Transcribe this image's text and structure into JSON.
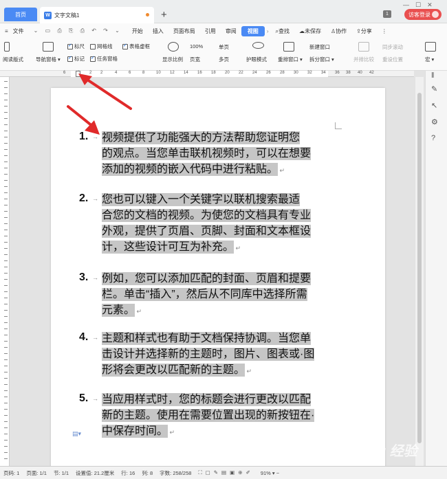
{
  "tabs": {
    "home": "首页",
    "doc": "文字文稿1"
  },
  "titlebar": {
    "page_badge": "1",
    "login": "访客登录"
  },
  "menu": {
    "file": "文件",
    "items": [
      "开始",
      "插入",
      "页面布局",
      "引用",
      "审阅",
      "视图"
    ],
    "search": "查找",
    "unsaved": "未保存",
    "collab": "协作",
    "share": "分享"
  },
  "toolbar": {
    "readmode": "阅读版式",
    "nav": "导航窗格",
    "ruler": "标尺",
    "gridlines": "网格线",
    "tableframe": "表格虚框",
    "marks": "标记",
    "taskpane": "任务窗格",
    "zoom": "显示比例",
    "zoom100": "100%",
    "pagewidth": "页宽",
    "single": "单页",
    "multi": "多页",
    "eyecare": "护眼模式",
    "rearrange": "重排窗口",
    "newwin": "新建窗口",
    "split": "拆分窗口",
    "compare": "并排比较",
    "syncscroll": "同步滚动",
    "resetpos": "重设位置",
    "macro": "宏"
  },
  "ruler": {
    "nums": [
      "6",
      "4",
      "2",
      "2",
      "4",
      "6",
      "8",
      "10",
      "12",
      "14",
      "16",
      "18",
      "20",
      "22",
      "24",
      "26",
      "28",
      "30",
      "32",
      "34",
      "36",
      "38",
      "40",
      "42",
      "44",
      "46"
    ]
  },
  "document": {
    "items": [
      {
        "num": "1.",
        "lines": [
          "视频提供了功能强大的方法帮助您证明您",
          "的观点。当您单击联机视频时，可以在想要",
          "添加的视频的嵌入代码中进行粘贴。"
        ]
      },
      {
        "num": "2.",
        "lines": [
          "您也可以键入一个关键字以联机搜索最适",
          "合您的文档的视频。为使您的文档具有专业",
          "外观，提供了页眉、页脚、封面和文本框设",
          "计，这些设计可互为补充。"
        ]
      },
      {
        "num": "3.",
        "lines": [
          "例如，您可以添加匹配的封面、页眉和提要",
          "栏。单击“插入”，然后从不同库中选择所需",
          "元素。"
        ]
      },
      {
        "num": "4.",
        "lines": [
          "主题和样式也有助于文档保持协调。当您单",
          "击设计并选择新的主题时，图片、图表或·图",
          "形将会更改以匹配新的主题。"
        ]
      },
      {
        "num": "5.",
        "lines": [
          "当应用样式时，您的标题会进行更改以匹配",
          "新的主题。使用在需要位置出现的新按钮在·",
          "中保存时间。"
        ]
      }
    ]
  },
  "status": {
    "page": "页码: 1",
    "pages": "页面: 1/1",
    "section": "节: 1/1",
    "setting": "设置值: 21.2厘米",
    "row": "行: 16",
    "col": "列: 8",
    "words": "字数: 258/258",
    "zoom": "91%"
  },
  "watermark": "Bai du 经验"
}
